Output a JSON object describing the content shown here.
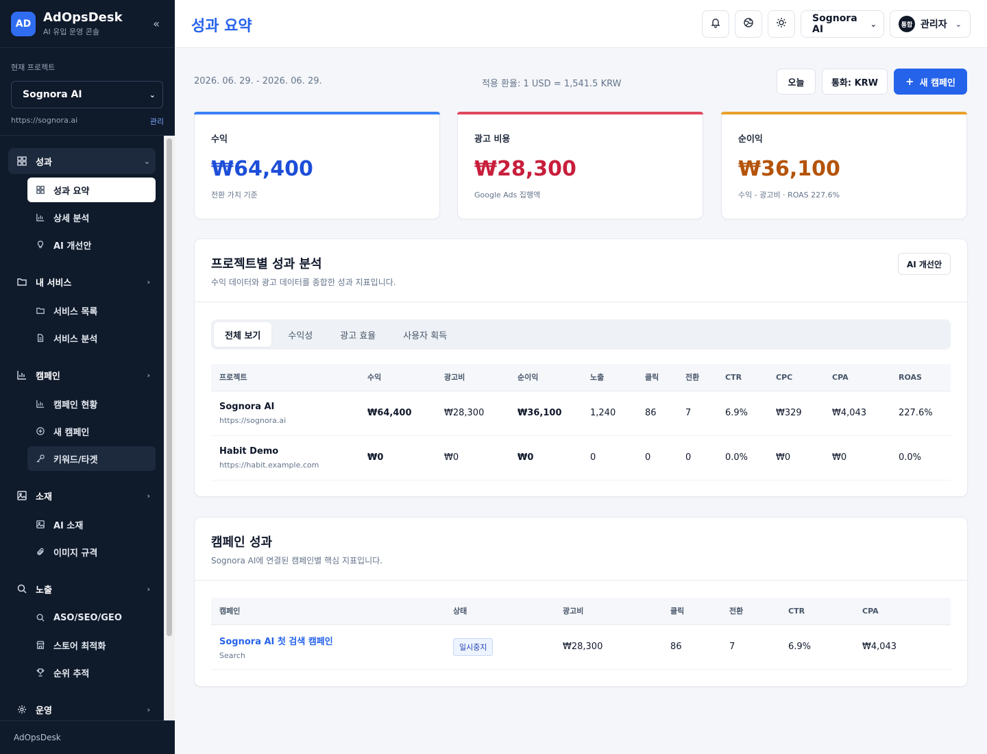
{
  "brand": {
    "logo": "AD",
    "name": "AdOpsDesk",
    "subtitle": "AI 유입 운영 콘솔",
    "collapse_icon": "«"
  },
  "project": {
    "label": "현재 프로젝트",
    "selected": "Sognora AI",
    "url": "https://sognora.ai",
    "manage": "관리"
  },
  "nav": {
    "groups": [
      {
        "label": "성과",
        "icon": "grid-icon",
        "items": [
          "성과 요약",
          "상세 분석",
          "AI 개선안"
        ]
      },
      {
        "label": "내 서비스",
        "icon": "folder-icon",
        "items": [
          "서비스 목록",
          "서비스 분석"
        ]
      },
      {
        "label": "캠페인",
        "icon": "bar-chart-icon",
        "items": [
          "캠페인 현황",
          "새 캠페인",
          "키워드/타겟"
        ]
      },
      {
        "label": "소재",
        "icon": "image-icon",
        "items": [
          "AI 소재",
          "이미지 규격"
        ]
      },
      {
        "label": "노출",
        "icon": "search-icon",
        "items": [
          "ASO/SEO/GEO",
          "스토어 최적화",
          "순위 추적"
        ]
      },
      {
        "label": "운영",
        "icon": "gear-icon",
        "items": []
      }
    ]
  },
  "footer": {
    "label": "AdOpsDesk"
  },
  "topbar": {
    "title": "성과 요약",
    "project_select": "Sognora AI",
    "user_avatar": "통합",
    "user_name": "관리자"
  },
  "toolbar": {
    "date_range": "2026. 06. 29. - 2026. 06. 29.",
    "fx_rate": "적용 환율: 1 USD = 1,541.5 KRW",
    "today": "오늘",
    "currency": "통화: KRW",
    "new_campaign": "새 캠페인"
  },
  "kpis": {
    "revenue": {
      "label": "수익",
      "value": "₩64,400",
      "sub": "전환 가치 기준"
    },
    "ad_cost": {
      "label": "광고 비용",
      "value": "₩28,300",
      "sub": "Google Ads 집행액"
    },
    "net": {
      "label": "순이익",
      "value": "₩36,100",
      "sub": "수익 - 광고비 · ROAS 227.6%"
    }
  },
  "project_perf": {
    "title": "프로젝트별 성과 분석",
    "desc": "수익 데이터와 광고 데이터를 종합한 성과 지표입니다.",
    "ai_button": "AI 개선안",
    "tabs": [
      "전체 보기",
      "수익성",
      "광고 효율",
      "사용자 획득"
    ],
    "columns": [
      "프로젝트",
      "수익",
      "광고비",
      "순이익",
      "노출",
      "클릭",
      "전환",
      "CTR",
      "CPC",
      "CPA",
      "ROAS"
    ],
    "rows": [
      {
        "name": "Sognora AI",
        "url": "https://sognora.ai",
        "revenue": "₩64,400",
        "cost": "₩28,300",
        "net": "₩36,100",
        "impressions": "1,240",
        "clicks": "86",
        "conversions": "7",
        "ctr": "6.9%",
        "cpc": "₩329",
        "cpa": "₩4,043",
        "roas": "227.6%"
      },
      {
        "name": "Habit Demo",
        "url": "https://habit.example.com",
        "revenue": "₩0",
        "cost": "₩0",
        "net": "₩0",
        "impressions": "0",
        "clicks": "0",
        "conversions": "0",
        "ctr": "0.0%",
        "cpc": "₩0",
        "cpa": "₩0",
        "roas": "0.0%"
      }
    ]
  },
  "campaign_perf": {
    "title": "캠페인 성과",
    "desc": "Sognora AI에 연결된 캠페인별 핵심 지표입니다.",
    "columns": [
      "캠페인",
      "상태",
      "광고비",
      "클릭",
      "전환",
      "CTR",
      "CPA"
    ],
    "rows": [
      {
        "name": "Sognora AI 첫 검색 캠페인",
        "type": "Search",
        "status": "일시중지",
        "cost": "₩28,300",
        "clicks": "86",
        "conversions": "7",
        "ctr": "6.9%",
        "cpa": "₩4,043"
      }
    ]
  },
  "colors": {
    "primary": "#2563eb",
    "revenue": "#1d4ed8",
    "cost": "#c81e3c",
    "net": "#b45309",
    "sidebar": "#0f1a2b"
  }
}
